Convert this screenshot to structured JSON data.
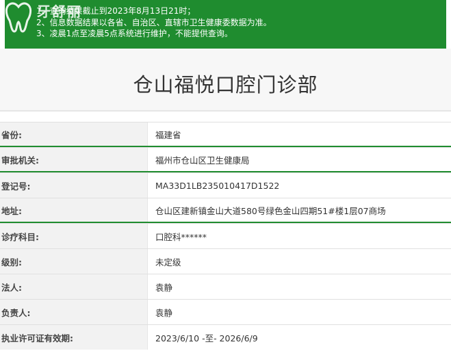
{
  "notice": {
    "lines": [
      "1、查询结果截止到2023年8月13日21时；",
      "2、信息数据结果以各省、自治区、直辖市卫生健康委数据为准。",
      "3、凌晨1点至凌晨5点系统进行维护，不能提供查询。"
    ]
  },
  "logo": {
    "brand_line1": "牙舒丽",
    "brand_line2": ""
  },
  "page": {
    "title": "仓山福悦口腔门诊部"
  },
  "rows": [
    {
      "label": "省份:",
      "value": "福建省"
    },
    {
      "label": "审批机关:",
      "value": "福州市仓山区卫生健康局"
    },
    {
      "label": "登记号:",
      "value": "MA33D1LB235010417D1522"
    },
    {
      "label": "地址:",
      "value": "仓山区建新镇金山大道580号绿色金山四期51#楼1层07商场"
    },
    {
      "label": "诊疗科目:",
      "value": "口腔科******"
    },
    {
      "label": "级别:",
      "value": "未定级"
    },
    {
      "label": "法人:",
      "value": "袁静"
    },
    {
      "label": "负责人:",
      "value": "袁静"
    },
    {
      "label": "执业许可证有效期:",
      "value": "2023/6/10 -至- 2026/6/9"
    }
  ],
  "colors": {
    "accent_green": "#1f8c2f"
  }
}
